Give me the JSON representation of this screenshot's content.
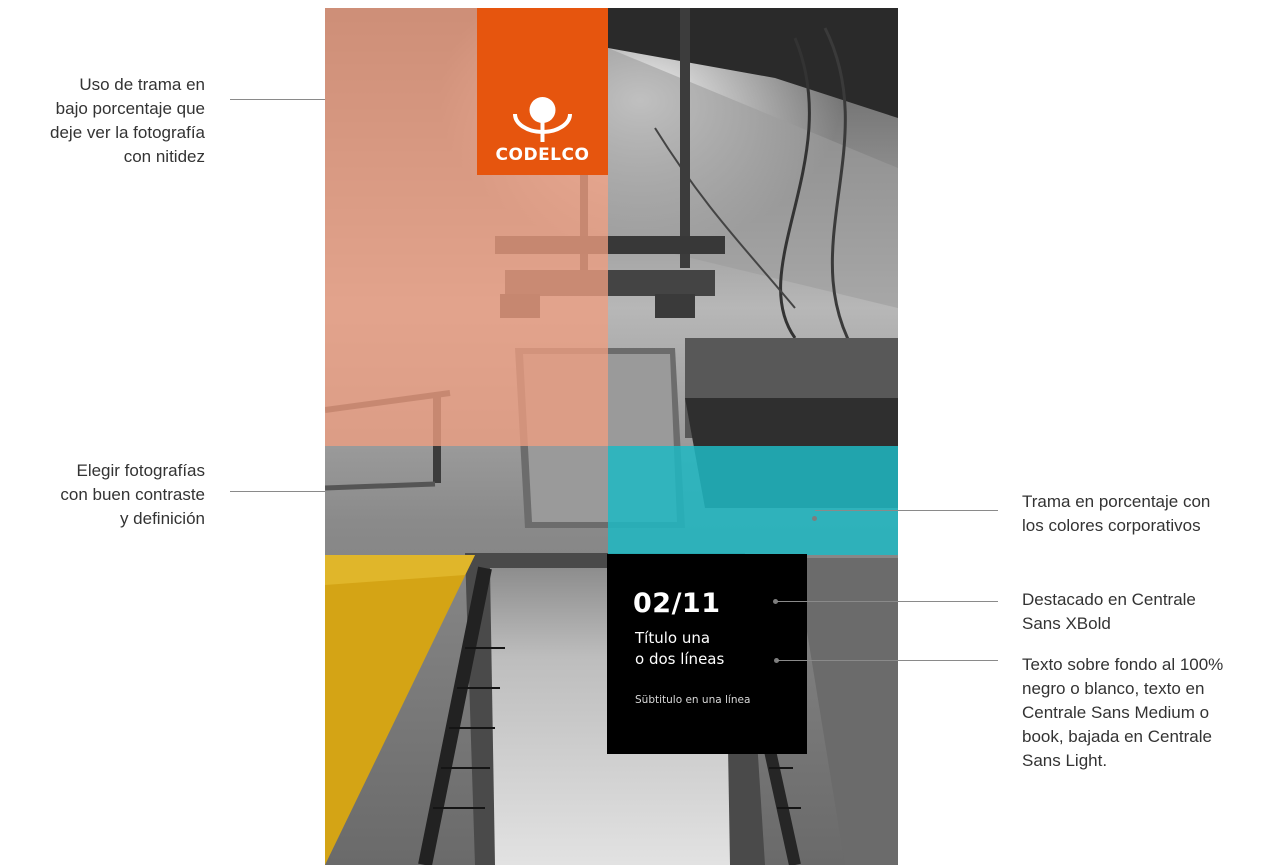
{
  "annotations": {
    "trama_bajo": "Uso de trama en\nbajo porcentaje que\ndeje ver la fotografía\ncon nitidez",
    "elegir_fotos": "Elegir fotografías\ncon buen contraste\ny definición",
    "trama_colores": "Trama en porcentaje con\nlos colores corporativos",
    "destacado": "Destacado en Centrale\nSans XBold",
    "texto_fondo": "Texto sobre fondo al 100%\nnegro o blanco, texto en\nCentrale Sans Medium o\nbook, bajada en Centrale\nSans Light."
  },
  "poster": {
    "logo_text": "CODELCO",
    "number": "02/11",
    "title": "Título una\no dos líneas",
    "subtitle": "Sübtitulo en una línea"
  },
  "colors": {
    "orange_brand": "#e6550e",
    "orange_tint": "#ee9e80",
    "teal_tint": "#1eb9c3",
    "yellow": "#d4a415",
    "black": "#000000"
  },
  "icons": {
    "logo": "codelco-logo-icon"
  }
}
